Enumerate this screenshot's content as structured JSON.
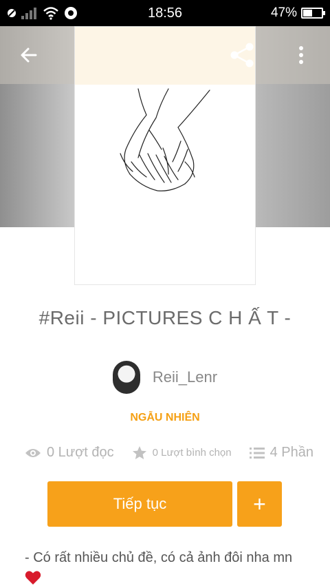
{
  "status_bar": {
    "time": "18:56",
    "battery_percent": "47%",
    "battery_level": 0.47
  },
  "toolbar": {
    "back_icon": "arrow-left-icon",
    "share_icon": "share-icon",
    "menu_icon": "more-vertical-icon"
  },
  "story": {
    "title": "#Reii -  PICTURES C H Ấ T  -",
    "author": "Reii_Lenr",
    "category": "NGẪU NHIÊN",
    "reads": "0 Lượt đọc",
    "votes": "0 Lượt bình chọn",
    "parts": "4 Phần",
    "description": "- Có rất nhiều chủ đề, có cả ảnh đôi nha mn"
  },
  "actions": {
    "continue_label": "Tiếp tục",
    "add_label": "+"
  },
  "colors": {
    "accent": "#f7a11a",
    "category": "#f5a014",
    "muted": "#b3b3b3"
  }
}
